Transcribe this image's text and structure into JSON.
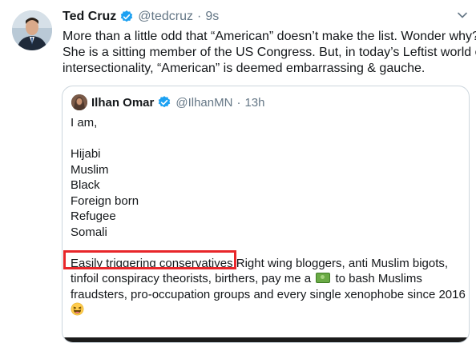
{
  "tweet": {
    "author_name": "Ted Cruz",
    "author_handle": "@tedcruz",
    "separator": "·",
    "time": "9s",
    "lines": [
      "More than a little odd that “American” doesn’t make the list. Wonder why?",
      "She is a sitting member of the US Congress. But, in today’s Leftist world of",
      "intersectionality, “American” is deemed embarrassing & gauche."
    ],
    "avatar_icon": "person-avatar-icon",
    "verified_icon": "verified-badge-icon",
    "menu_icon": "chevron-down-icon"
  },
  "quoted_tweet": {
    "author_name": "Ilhan Omar",
    "author_handle": "@IlhanMN",
    "separator": "·",
    "time": "13h",
    "intro": "I am,",
    "identities": [
      "Hijabi",
      "Muslim",
      "Black",
      "Foreign born",
      "Refugee",
      "Somali"
    ],
    "highlighted_phrase": "Easily triggering conservatives",
    "line1_rest": " Right wing bloggers, anti Muslim bigots,",
    "line2_before_emoji": "tinfoil conspiracy theorists, birthers, pay me a",
    "line2_after_emoji": " to bash Muslims",
    "line3": "fraudsters, pro-occupation groups  and every single xenophobe since 2016",
    "money_emoji_icon": "dollar-banknote-icon",
    "laugh_emoji_icon": "laughing-face-icon"
  },
  "colors": {
    "text": "#14171a",
    "secondary": "#657786",
    "verified": "#1da1f2",
    "highlight_box": "#e8262a",
    "border": "#ccd6dd"
  }
}
